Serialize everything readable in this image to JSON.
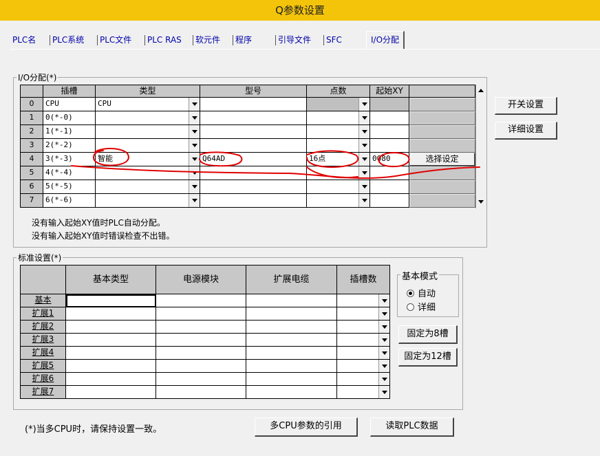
{
  "window": {
    "title": "Q参数设置"
  },
  "tabs": [
    {
      "label": "PLC名",
      "active": false
    },
    {
      "label": "PLC系统",
      "active": false
    },
    {
      "label": "PLC文件",
      "active": false
    },
    {
      "label": "PLC RAS",
      "active": false
    },
    {
      "label": "软元件",
      "active": false
    },
    {
      "label": "程序",
      "active": false
    },
    {
      "label": "引导文件",
      "active": false
    },
    {
      "label": "SFC",
      "active": false
    },
    {
      "label": "I/O分配",
      "active": true
    }
  ],
  "io": {
    "group_title": "I/O分配(*)",
    "headers": {
      "slot": "插槽",
      "type": "类型",
      "model": "型号",
      "points": "点数",
      "start_xy": "起始XY"
    },
    "rows": [
      {
        "num": "0",
        "slot": "CPU",
        "type": "CPU",
        "model": "",
        "points": "",
        "start": "",
        "detail": ""
      },
      {
        "num": "1",
        "slot": "0(*-0)",
        "type": "",
        "model": "",
        "points": "",
        "start": "",
        "detail": ""
      },
      {
        "num": "2",
        "slot": "1(*-1)",
        "type": "",
        "model": "",
        "points": "",
        "start": "",
        "detail": ""
      },
      {
        "num": "3",
        "slot": "2(*-2)",
        "type": "",
        "model": "",
        "points": "",
        "start": "",
        "detail": ""
      },
      {
        "num": "4",
        "slot": "3(*-3)",
        "type": "智能",
        "model": "Q64AD",
        "points": "16点",
        "start": "0080",
        "detail": "选择设定"
      },
      {
        "num": "5",
        "slot": "4(*-4)",
        "type": "",
        "model": "",
        "points": "",
        "start": "",
        "detail": ""
      },
      {
        "num": "6",
        "slot": "5(*-5)",
        "type": "",
        "model": "",
        "points": "",
        "start": "",
        "detail": ""
      },
      {
        "num": "7",
        "slot": "6(*-6)",
        "type": "",
        "model": "",
        "points": "",
        "start": "",
        "detail": ""
      }
    ],
    "switch_settings_label": "开关设置",
    "detail_settings_label": "详细设置",
    "note1": "没有输入起始XY值时PLC自动分配。",
    "note2": "没有输入起始XY值时错误检查不出错。"
  },
  "std": {
    "group_title": "标准设置(*)",
    "headers": {
      "base_model": "基本类型",
      "power": "电源模块",
      "cable": "扩展电缆",
      "slots": "插槽数"
    },
    "rows": [
      {
        "label": "基本"
      },
      {
        "label": "扩展1"
      },
      {
        "label": "扩展2"
      },
      {
        "label": "扩展3"
      },
      {
        "label": "扩展4"
      },
      {
        "label": "扩展5"
      },
      {
        "label": "扩展6"
      },
      {
        "label": "扩展7"
      }
    ],
    "base_mode": {
      "title": "基本模式",
      "auto": "自动",
      "detail": "详细",
      "selected": "auto"
    },
    "fixed8_label": "固定为8槽",
    "fixed12_label": "固定为12槽"
  },
  "footer": {
    "note": "(*)当多CPU时，请保持设置一致。",
    "multi_cpu_label": "多CPU参数的引用",
    "read_plc_label": "读取PLC数据"
  },
  "colors": {
    "title_bar": "#f4c40a",
    "annotation": "#e00000",
    "tab_text": "#0000aa"
  }
}
